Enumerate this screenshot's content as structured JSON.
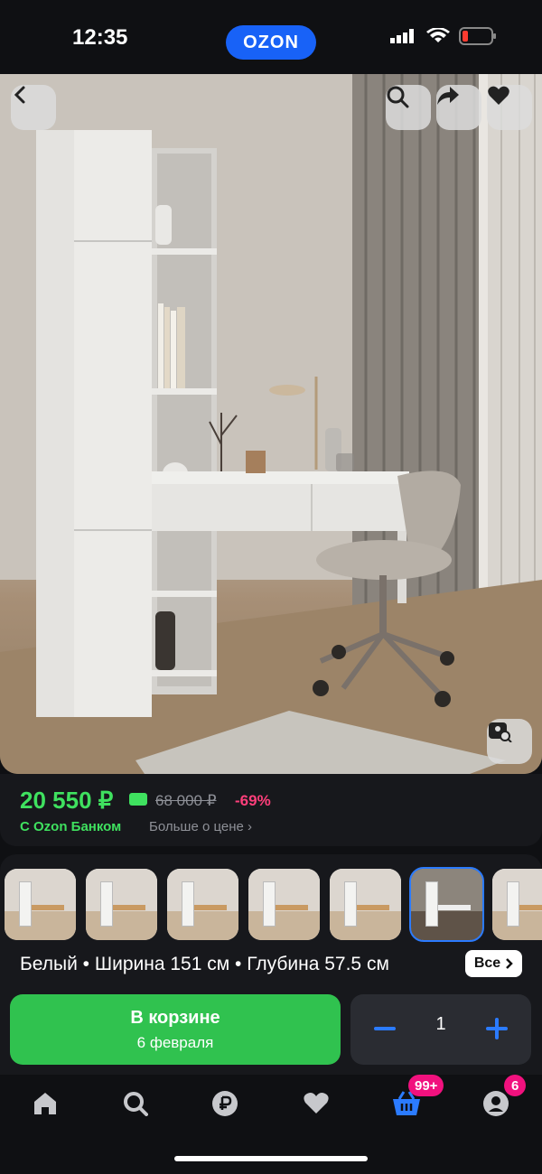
{
  "status_bar": {
    "time": "12:35",
    "app_logo": "OZON",
    "icons": [
      "signal-icon",
      "wifi-icon",
      "battery-icon"
    ]
  },
  "hero": {
    "buttons": [
      "back-icon",
      "search-icon",
      "share-icon",
      "heart-icon",
      "image-search-icon"
    ]
  },
  "price": {
    "current": "20 550 ₽",
    "old": "68 000 ₽",
    "discount": "-69%",
    "bank_label": "С Ozon Банком",
    "more_label": "Больше о цене ›"
  },
  "variants": {
    "description": "Белый • Ширина 151 см • Глубина 57.5 см",
    "all_label": "Все",
    "selected_index": 5
  },
  "cart": {
    "title": "В корзине",
    "subtitle": "6 февраля",
    "quantity": "1"
  },
  "nav": {
    "cart_badge": "99+",
    "profile_badge": "6"
  },
  "colors": {
    "accent": "#1862f7",
    "price_green": "#3fe15f",
    "cart_green": "#30c24f",
    "discount": "#ff3f7b"
  }
}
